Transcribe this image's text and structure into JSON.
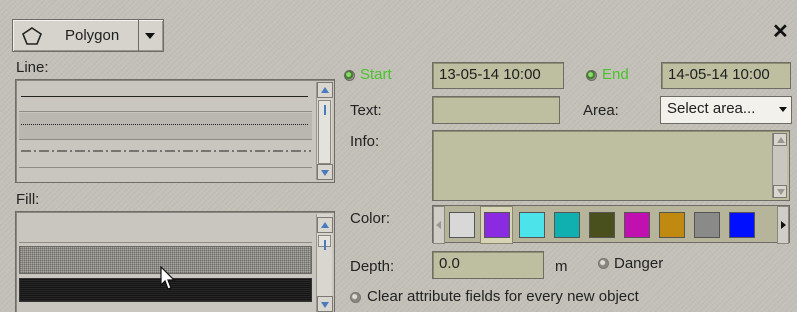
{
  "toolbar": {
    "tool_label": "Polygon",
    "tool_icon": "polygon-icon",
    "close_icon": "close-icon"
  },
  "line_section": {
    "label": "Line:",
    "styles": [
      "solid",
      "dotted",
      "dash-dot"
    ]
  },
  "fill_section": {
    "label": "Fill:",
    "styles": [
      "empty",
      "fine-gray-pattern",
      "dense-dark-pattern"
    ]
  },
  "start": {
    "label": "Start",
    "value": "13-05-14 10:00"
  },
  "end": {
    "label": "End",
    "value": "14-05-14 10:00"
  },
  "text_field": {
    "label": "Text:",
    "value": ""
  },
  "area": {
    "label": "Area:",
    "selected": "Select area..."
  },
  "info": {
    "label": "Info:",
    "value": ""
  },
  "color": {
    "label": "Color:",
    "swatches": [
      "#d8d8d8",
      "#8a2be2",
      "#4de3ea",
      "#10b0b0",
      "#4a4f1e",
      "#c010b0",
      "#c08a10",
      "#8a8a88",
      "#0010ff"
    ],
    "selected_index": 1
  },
  "depth": {
    "label": "Depth:",
    "value": "0.0",
    "unit": "m"
  },
  "danger": {
    "label": "Danger"
  },
  "clear_option": {
    "label": "Clear attribute fields for every new object"
  },
  "colors": {
    "accent_green": "#49c32a",
    "field_bg": "#bdbfa0",
    "panel_bg": "#c3c0b8"
  }
}
